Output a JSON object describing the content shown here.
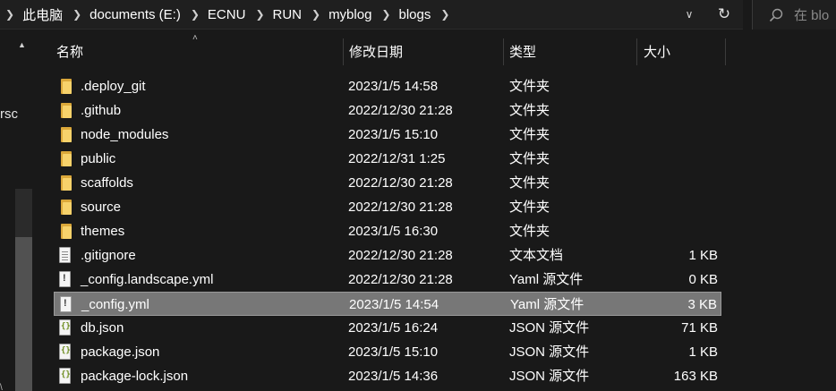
{
  "address": {
    "crumbs": [
      "此电脑",
      "documents (E:)",
      "ECNU",
      "RUN",
      "myblog",
      "blogs"
    ],
    "search_placeholder": "在 blo"
  },
  "nav": {
    "partial_text": "rsc",
    "partial_text_bottom": "\\"
  },
  "columns": {
    "name": "名称",
    "date": "修改日期",
    "type": "类型",
    "size": "大小"
  },
  "files": [
    {
      "name": ".deploy_git",
      "date": "2023/1/5 14:58",
      "type": "文件夹",
      "size": "",
      "icon": "folder-icon"
    },
    {
      "name": ".github",
      "date": "2022/12/30 21:28",
      "type": "文件夹",
      "size": "",
      "icon": "folder-icon"
    },
    {
      "name": "node_modules",
      "date": "2023/1/5 15:10",
      "type": "文件夹",
      "size": "",
      "icon": "folder-icon"
    },
    {
      "name": "public",
      "date": "2022/12/31 1:25",
      "type": "文件夹",
      "size": "",
      "icon": "folder-icon"
    },
    {
      "name": "scaffolds",
      "date": "2022/12/30 21:28",
      "type": "文件夹",
      "size": "",
      "icon": "folder-icon"
    },
    {
      "name": "source",
      "date": "2022/12/30 21:28",
      "type": "文件夹",
      "size": "",
      "icon": "folder-icon"
    },
    {
      "name": "themes",
      "date": "2023/1/5 16:30",
      "type": "文件夹",
      "size": "",
      "icon": "folder-icon"
    },
    {
      "name": ".gitignore",
      "date": "2022/12/30 21:28",
      "type": "文本文档",
      "size": "1 KB",
      "icon": "text-file-icon"
    },
    {
      "name": "_config.landscape.yml",
      "date": "2022/12/30 21:28",
      "type": "Yaml 源文件",
      "size": "0 KB",
      "icon": "yaml-file-icon"
    },
    {
      "name": "_config.yml",
      "date": "2023/1/5 14:54",
      "type": "Yaml 源文件",
      "size": "3 KB",
      "icon": "yaml-file-icon",
      "selected": true
    },
    {
      "name": "db.json",
      "date": "2023/1/5 16:24",
      "type": "JSON 源文件",
      "size": "71 KB",
      "icon": "json-file-icon"
    },
    {
      "name": "package.json",
      "date": "2023/1/5 15:10",
      "type": "JSON 源文件",
      "size": "1 KB",
      "icon": "json-file-icon"
    },
    {
      "name": "package-lock.json",
      "date": "2023/1/5 14:36",
      "type": "JSON 源文件",
      "size": "163 KB",
      "icon": "json-file-icon"
    }
  ],
  "colors": {
    "background": "#191919",
    "selected_row": "#777777",
    "folder": "#f7d26b"
  }
}
